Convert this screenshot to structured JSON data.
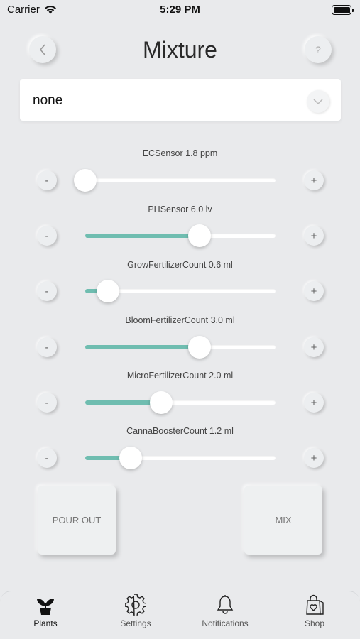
{
  "status_bar": {
    "carrier": "Carrier",
    "time": "5:29 PM"
  },
  "header": {
    "title": "Mixture",
    "back_icon": "chevron-left-icon",
    "help_label": "?"
  },
  "dropdown": {
    "value": "none",
    "icon": "chevron-down-icon"
  },
  "sliders": [
    {
      "label": "ECSensor 1.8 ppm",
      "minus": "-",
      "plus": "+",
      "fraction": 0.0
    },
    {
      "label": "PHSensor 6.0 lv",
      "minus": "-",
      "plus": "+",
      "fraction": 0.6
    },
    {
      "label": "GrowFertilizerCount 0.6 ml",
      "minus": "-",
      "plus": "+",
      "fraction": 0.12
    },
    {
      "label": "BloomFertilizerCount 3.0 ml",
      "minus": "-",
      "plus": "+",
      "fraction": 0.6
    },
    {
      "label": "MicroFertilizerCount 2.0 ml",
      "minus": "-",
      "plus": "+",
      "fraction": 0.4
    },
    {
      "label": "CannaBoosterCount 1.2 ml",
      "minus": "-",
      "plus": "+",
      "fraction": 0.24
    }
  ],
  "actions": {
    "pour_out": "POUR OUT",
    "mix": "MIX"
  },
  "tabs": [
    {
      "label": "Plants",
      "icon": "plant-icon",
      "active": true
    },
    {
      "label": "Settings",
      "icon": "gear-icon",
      "active": false
    },
    {
      "label": "Notifications",
      "icon": "bell-icon",
      "active": false
    },
    {
      "label": "Shop",
      "icon": "shopping-bag-icon",
      "active": false
    }
  ],
  "colors": {
    "accent": "#6fbdb0",
    "background": "#e9eaec"
  }
}
